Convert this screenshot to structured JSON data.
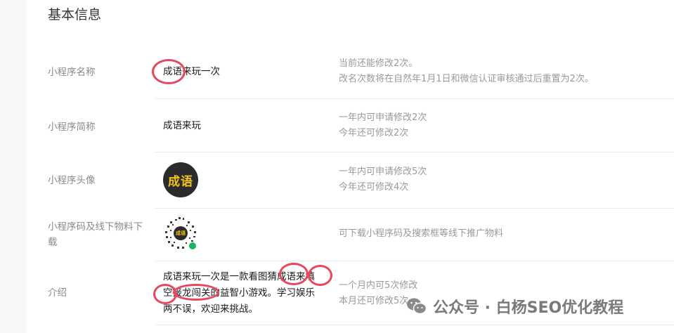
{
  "section": {
    "title": "基本信息"
  },
  "rows": {
    "name": {
      "label": "小程序名称",
      "value": "成语来玩一次",
      "desc1": "当前还能修改2次。",
      "desc2": "改名次数将在自然年1月1日和微信认证审核通过后重置为2次。"
    },
    "short": {
      "label": "小程序简称",
      "value": "成语来玩",
      "desc1": "一年内可申请修改2次",
      "desc2": "今年还可修改2次"
    },
    "avatar": {
      "label": "小程序头像",
      "avatar_text": "成语",
      "desc1": "一年内可申请修改5次",
      "desc2": "今年还可修改4次"
    },
    "qrcode": {
      "label1": "小程序码及线下物料下",
      "label2": "载",
      "center_text": "成语",
      "desc1": "可下载小程序码及搜索框等线下推广物料"
    },
    "intro": {
      "label": "介绍",
      "line1": "成语来玩一次是一款看图猜成语来填",
      "line2": "空接龙闯关的益智小游戏。学习娱乐",
      "line3": "两不误，欢迎来挑战。",
      "desc1": "一个月内可5次修改",
      "desc2": "本月还可修改5次"
    }
  },
  "watermark": {
    "text": "公众号 · 白杨SEO优化教程",
    "icon": "wechat-icon"
  },
  "colors": {
    "annotation": "#e8475e",
    "avatar_bg": "#2b2b2b",
    "avatar_text": "#f3c21c"
  }
}
